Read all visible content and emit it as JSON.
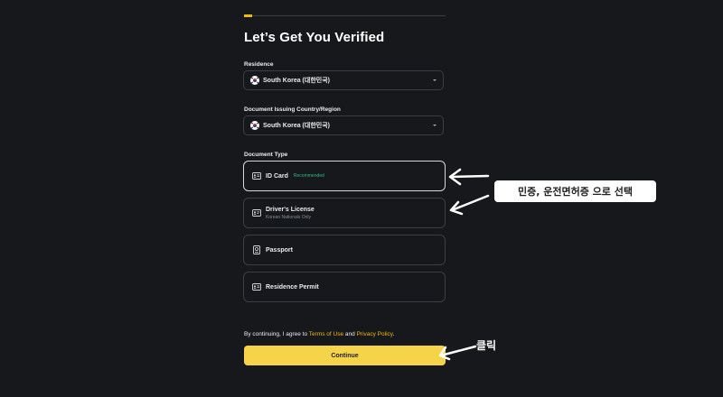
{
  "progress": {
    "fraction": 0.04
  },
  "page": {
    "title": "Let’s Get You Verified"
  },
  "residence": {
    "label": "Residence",
    "value": "South Korea (대한민국)"
  },
  "issuing": {
    "label": "Document Issuing Country/Region",
    "value": "South Korea (대한민국)"
  },
  "doc_type": {
    "label": "Document Type",
    "options": [
      {
        "label": "ID Card",
        "badge": "Recommended",
        "icon": "id-card-icon",
        "selected": true
      },
      {
        "label": "Driver's License",
        "sublabel": "Korean Nationals Only",
        "icon": "license-icon",
        "selected": false
      },
      {
        "label": "Passport",
        "icon": "passport-icon",
        "selected": false
      },
      {
        "label": "Residence Permit",
        "icon": "permit-icon",
        "selected": false
      }
    ]
  },
  "consent": {
    "prefix": "By continuing, I agree to ",
    "terms": "Terms of Use",
    "and": " and ",
    "privacy": "Privacy Policy",
    "suffix": "."
  },
  "continue_label": "Continue",
  "annotations": {
    "callout": "민증, 운전면허증 으로 선택",
    "click": "클릭"
  },
  "colors": {
    "background": "#17181b",
    "accent": "#f0b90b",
    "button": "#f5d44a",
    "recommended": "#2ebd85"
  }
}
